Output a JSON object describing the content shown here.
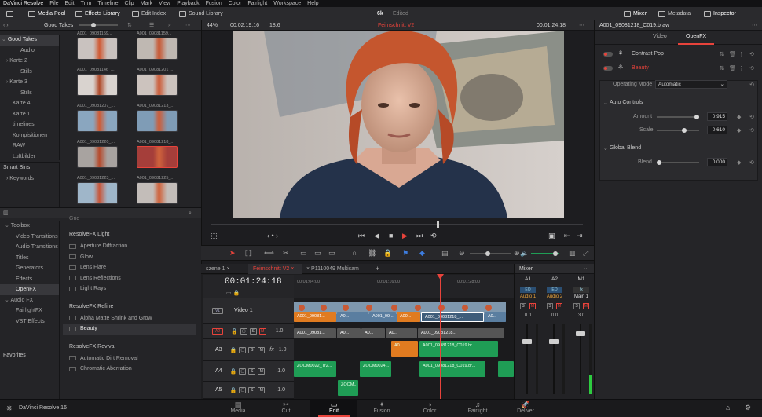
{
  "menu": [
    "DaVinci Resolve",
    "File",
    "Edit",
    "Trim",
    "Timeline",
    "Clip",
    "Mark",
    "View",
    "Playback",
    "Fusion",
    "Color",
    "Fairlight",
    "Workspace",
    "Help"
  ],
  "toolbar": {
    "media_pool": "Media Pool",
    "effects_library": "Effects Library",
    "edit_index": "Edit Index",
    "sound_library": "Sound Library",
    "project_name": "6k",
    "project_status": "Edited",
    "mixer": "Mixer",
    "metadata": "Metadata",
    "inspector": "Inspector"
  },
  "media_pool": {
    "bin_title": "Good Takes",
    "bins": [
      {
        "label": "Good Takes",
        "selected": true
      },
      {
        "label": "Audio"
      },
      {
        "label": "Karte 2"
      },
      {
        "label": "Stills"
      },
      {
        "label": "Karte 3"
      },
      {
        "label": "Stills"
      },
      {
        "label": "Karte 4"
      },
      {
        "label": "Karte 1"
      },
      {
        "label": "timelines"
      },
      {
        "label": "Kompisitionen"
      },
      {
        "label": "RAW"
      },
      {
        "label": "Luftbilder"
      }
    ],
    "smart_bins": "Smart Bins",
    "keywords": "Keywords",
    "clips": [
      {
        "name": "A001_09081159..."
      },
      {
        "name": "A001_09081159..."
      },
      {
        "name": "A001_09081146_..."
      },
      {
        "name": "A001_09081201_..."
      },
      {
        "name": "A001_09081207_..."
      },
      {
        "name": "A001_09081213_..."
      },
      {
        "name": "A001_09081220_..."
      },
      {
        "name": "A001_09081218_..."
      },
      {
        "name": "A001_09081223_..."
      },
      {
        "name": "A001_09081225_..."
      }
    ]
  },
  "effects": {
    "tree": [
      {
        "label": "Toolbox"
      },
      {
        "label": "Video Transitions"
      },
      {
        "label": "Audio Transitions"
      },
      {
        "label": "Titles"
      },
      {
        "label": "Generators"
      },
      {
        "label": "Effects"
      },
      {
        "label": "OpenFX",
        "selected": true
      },
      {
        "label": "Audio FX"
      },
      {
        "label": "FairlightFX"
      },
      {
        "label": "VST Effects"
      }
    ],
    "favorites": "Favorites",
    "top_item": "Grid",
    "categories": [
      {
        "title": "ResolveFX Light",
        "items": [
          "Aperture Diffraction",
          "Glow",
          "Lens Flare",
          "Lens Reflections",
          "Light Rays"
        ]
      },
      {
        "title": "ResolveFX Refine",
        "items": [
          "Alpha Matte Shrink and Grow",
          "Beauty"
        ]
      },
      {
        "title": "ResolveFX Revival",
        "items": [
          "Automatic Dirt Removal",
          "Chromatic Aberration"
        ]
      }
    ]
  },
  "viewer": {
    "zoom": "44%",
    "source_timecode": "00:02:19:16",
    "audio_level": "18.6",
    "timeline_name": "Feimschnitt V2",
    "record_timecode": "00:01:24:18"
  },
  "timeline": {
    "tabs": [
      "szene 1",
      "Feimschnitt V2",
      "P1110049 Multicam"
    ],
    "timecode": "00:01:24:18",
    "ruler": [
      "00:01:04:00",
      "00:01:16:00",
      "00:01:28:00"
    ],
    "tracks": [
      {
        "id": "V1",
        "name": "Video 1"
      },
      {
        "id": "A2",
        "level": "1.0"
      },
      {
        "id": "A3",
        "level": "1.0",
        "fx": "fx"
      },
      {
        "id": "A4",
        "level": "1.0"
      },
      {
        "id": "A5",
        "level": "1.0"
      }
    ],
    "video_clips": [
      "A001_09081...",
      "A0...",
      "A001_09...",
      "A00...",
      "A001_09081218_...",
      "A0..."
    ],
    "a2_clips": [
      "A001_09081...",
      "A0...",
      "A0...",
      "A0...",
      "A001_09081218..."
    ],
    "a3_clips": [
      "A0...",
      "A001_09081218_C019.br..."
    ],
    "a4_clips": [
      "ZOOM0022_Tr2...",
      "ZOOM0024...",
      "A001_09081218_C019.br..."
    ],
    "a5_clips": [
      "ZOOM..."
    ]
  },
  "mixer": {
    "title": "Mixer",
    "channels": [
      {
        "id": "A1",
        "label": "Audio 1",
        "eq": "EQ",
        "value": "0.0"
      },
      {
        "id": "A2",
        "label": "Audio 2",
        "eq": "EQ",
        "value": "0.0"
      },
      {
        "id": "M1",
        "label": "Main 1",
        "fx": "fx",
        "value": "3.0"
      }
    ]
  },
  "inspector": {
    "clip_name": "A001_09081218_C019.braw",
    "tabs": [
      "Video",
      "OpenFX"
    ],
    "effects": [
      {
        "name": "Contrast Pop"
      },
      {
        "name": "Beauty",
        "active": true
      }
    ],
    "operating_mode_label": "Operating Mode",
    "operating_mode_value": "Automatic",
    "auto_controls": "Auto Controls",
    "amount_label": "Amount",
    "amount_value": "0.915",
    "scale_label": "Scale",
    "scale_value": "0.610",
    "global_blend": "Global Blend",
    "blend_label": "Blend",
    "blend_value": "0.000"
  },
  "pages": [
    "Media",
    "Cut",
    "Edit",
    "Fusion",
    "Color",
    "Fairlight",
    "Deliver"
  ],
  "active_page": "Edit",
  "app_name": "DaVinci Resolve 16",
  "colors": {
    "accent": "#e8433b",
    "orange": "#e07b20",
    "green": "#1f9d55",
    "blue": "#6a8fb0"
  }
}
